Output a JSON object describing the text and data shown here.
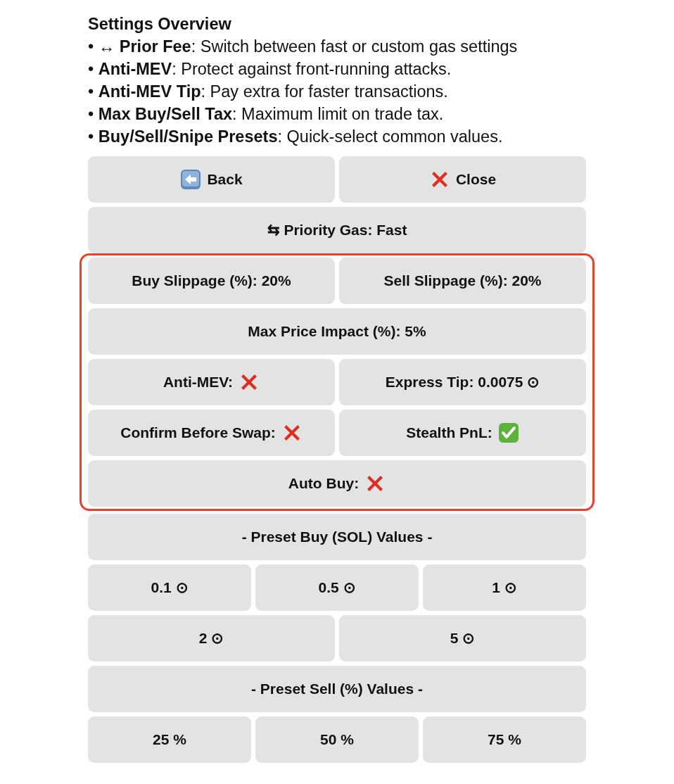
{
  "overview": {
    "title": "Settings Overview",
    "items": [
      "• **↔ Prior Fee**: Switch between fast or custom gas settings",
      "• **Anti-MEV**: Protect against front-running attacks.",
      "• **Anti-MEV Tip**: Pay extra for faster transactions.",
      "• **Max Buy/Sell Tax**: Maximum limit on trade tax.",
      "• **Buy/Sell/Snipe Presets**: Quick-select common values."
    ]
  },
  "sections": [
    {
      "highlighted": false,
      "rows": [
        [
          {
            "kind": "back",
            "label": "Back"
          },
          {
            "kind": "close",
            "label": "Close"
          }
        ],
        [
          {
            "kind": "plain",
            "label": "⇆ Priority Gas: Fast"
          }
        ]
      ]
    },
    {
      "highlighted": true,
      "rows": [
        [
          {
            "kind": "plain",
            "label": "Buy Slippage (%): 20%"
          },
          {
            "kind": "plain",
            "label": "Sell Slippage (%): 20%"
          }
        ],
        [
          {
            "kind": "plain",
            "label": "Max Price Impact (%): 5%"
          }
        ],
        [
          {
            "kind": "toggle",
            "label": "Anti-MEV:",
            "on": false
          },
          {
            "kind": "plain",
            "label": "Express Tip: 0.0075 ⊙"
          }
        ],
        [
          {
            "kind": "toggle",
            "label": "Confirm Before Swap:",
            "on": false
          },
          {
            "kind": "toggle",
            "label": "Stealth PnL:",
            "on": true
          }
        ],
        [
          {
            "kind": "toggle",
            "label": "Auto Buy:",
            "on": false
          }
        ]
      ]
    },
    {
      "highlighted": false,
      "rows": [
        [
          {
            "kind": "plain",
            "label": "- Preset Buy (SOL) Values -"
          }
        ],
        [
          {
            "kind": "plain",
            "label": "0.1 ⊙"
          },
          {
            "kind": "plain",
            "label": "0.5 ⊙"
          },
          {
            "kind": "plain",
            "label": "1 ⊙"
          }
        ],
        [
          {
            "kind": "plain",
            "label": "2 ⊙"
          },
          {
            "kind": "plain",
            "label": "5 ⊙"
          }
        ],
        [
          {
            "kind": "plain",
            "label": "- Preset Sell (%) Values -"
          }
        ],
        [
          {
            "kind": "plain",
            "label": "25 %"
          },
          {
            "kind": "plain",
            "label": "50 %"
          },
          {
            "kind": "plain",
            "label": "75 %"
          }
        ]
      ]
    }
  ]
}
